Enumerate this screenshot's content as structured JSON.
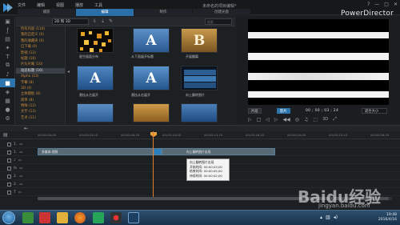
{
  "app": {
    "menu": [
      "文件",
      "编辑",
      "视图",
      "播放",
      "工具"
    ],
    "doc_title": "未命名的项目编辑*",
    "brand": "PowerDirector",
    "window_controls": [
      "?",
      "—",
      "□",
      "✕"
    ],
    "mode_tabs": [
      "捕获",
      "编辑",
      "制作",
      "创建光盘"
    ]
  },
  "library": {
    "dropdown": "2D 和 3D",
    "search_placeholder": "搜索",
    "categories": [
      {
        "label": "所有内容 (116)"
      },
      {
        "label": "我的自定义 (0)"
      },
      {
        "label": "我的收藏夹 (0)"
      },
      {
        "label": "已下载 (0)"
      },
      {
        "label": "影视 (12)"
      },
      {
        "label": "标题 (16)"
      },
      {
        "label": "片头片尾 (10)"
      },
      {
        "label": "动态标题 (16)",
        "selected": true
      },
      {
        "label": "Alpha (23)"
      },
      {
        "label": "字幕 (8)"
      },
      {
        "label": "3D (4)"
      },
      {
        "label": "立体模板 (8)"
      },
      {
        "label": "简单 (8)"
      },
      {
        "label": "特殊 (12)"
      },
      {
        "label": "文字 (13)"
      },
      {
        "label": "艺术 (11)"
      }
    ],
    "thumbnails": [
      {
        "caption": "星空画面分布"
      },
      {
        "caption": "从下面展开标题"
      },
      {
        "caption": "开展翻篇"
      },
      {
        "caption": "悬挂从左展开"
      },
      {
        "caption": "悬挂从右展开"
      },
      {
        "caption": "向上翻转图片"
      }
    ]
  },
  "preview": {
    "mode_clip": "片段",
    "mode_movie": "影片",
    "timecode": "00 ; 00 ; 03 ; 24",
    "fit_label": "适合大小",
    "dimension_label": "3D"
  },
  "timeline": {
    "ticks": [
      "00;00;00;00",
      "00;00;03;10",
      "00;00;06;20",
      "00;00;10;00",
      "00;00;13;10",
      "00;00;16;20",
      "00;00;20;00",
      "00;00;23;10",
      "00;00;26;20"
    ],
    "tracks": [
      "1.",
      "1.",
      "fx",
      "2.",
      "2.",
      "T"
    ],
    "video_clip_label": "多媒体-视频",
    "title_clip_label": "向上翻转图片出现",
    "tooltip": {
      "title": "向上翻转图片出现",
      "line1": "开始时间: 00:00:03;00",
      "line2": "结束时间: 00:00:05;00",
      "line3": "持续时间: 00:00:02;00"
    }
  },
  "taskbar": {
    "time": "19:48",
    "date": "2016/4/16"
  },
  "watermark": {
    "main": "Baidu经验",
    "sub": "jingyan.baidu.com"
  },
  "colors": {
    "accent": "#2f75ad",
    "playhead": "#e07f2f",
    "category_text": "#c78b3c"
  }
}
